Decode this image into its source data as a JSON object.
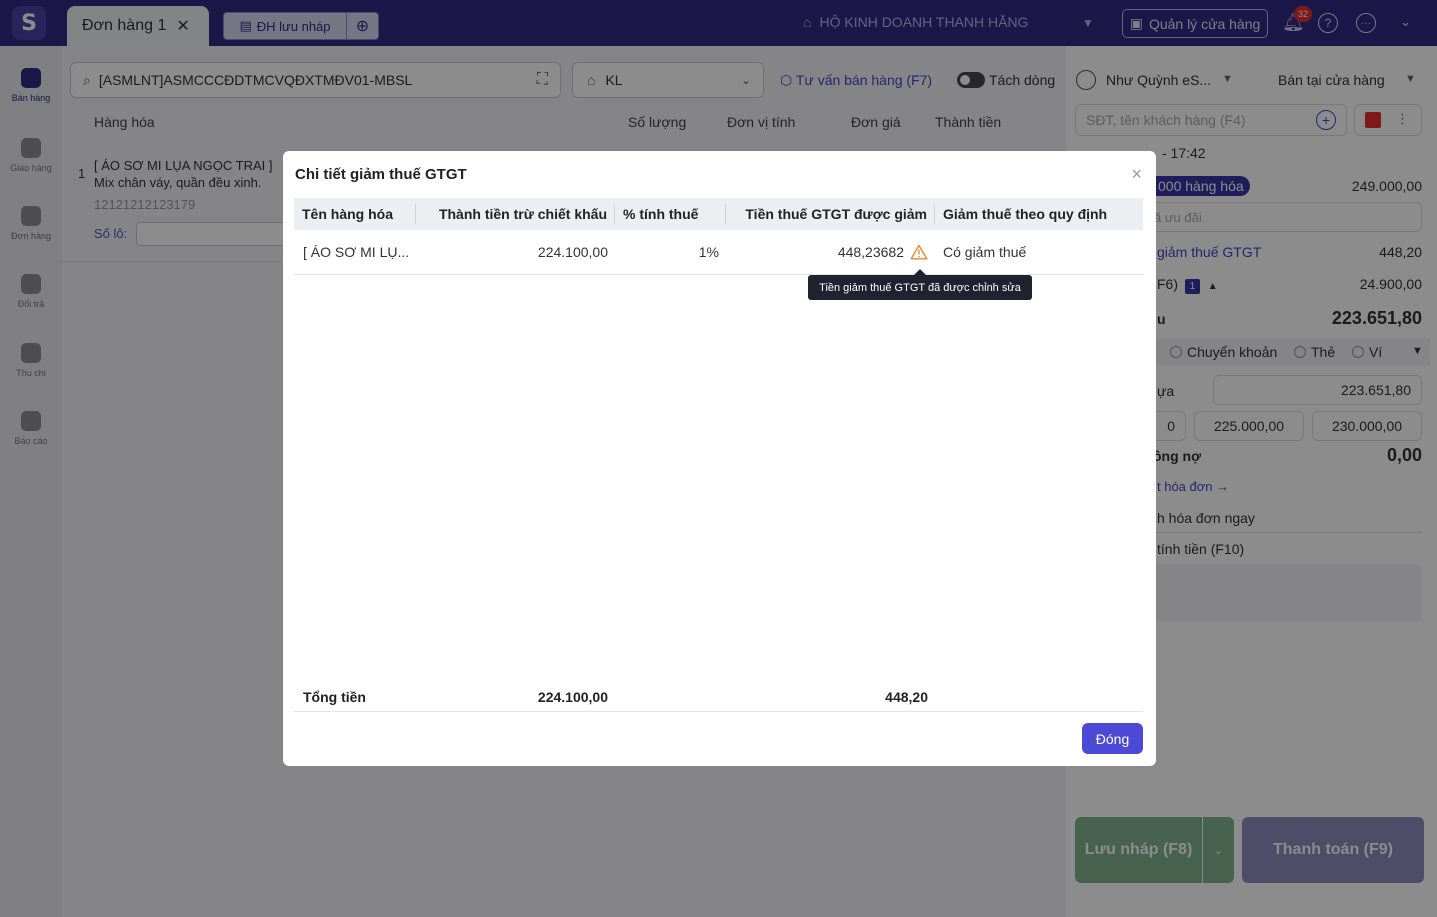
{
  "topbar": {
    "logo": "S",
    "active_tab": "Đơn hàng",
    "active_tab_number": "1",
    "close_glyph": "✕",
    "draft_tab": "ĐH lưu nháp",
    "store_name": "HỘ KINH DOANH THANH HẰNG",
    "manage_button": "Quản lý cửa hàng",
    "notification_count": "32",
    "help_glyph": "?",
    "more_glyph": "···",
    "icons": [
      "store-icon",
      "bell-icon",
      "help-icon",
      "more-icon",
      "chevron-down-icon"
    ]
  },
  "sidebar": {
    "items": [
      {
        "label": "Bán hàng",
        "active": true
      },
      {
        "label": "Giao hàng",
        "active": false
      },
      {
        "label": "Đơn hàng",
        "active": false
      },
      {
        "label": "Đổi trả",
        "active": false
      },
      {
        "label": "Thu chi",
        "active": false
      },
      {
        "label": "Báo cáo",
        "active": false
      }
    ]
  },
  "main": {
    "search_value": "[ASMLNT]ASMCCCĐDTMCVQĐXTMĐV01-MBSL",
    "price_list": "KL",
    "advise_link": "Tư vấn bán hàng (F7)",
    "split_line_label": "Tách dòng",
    "columns": [
      "Hàng hóa",
      "Số lượng",
      "Đơn vị tính",
      "Đơn giá",
      "Thành tiền"
    ],
    "product": {
      "index": "1",
      "name_line1": "[ ÁO SƠ MI LỤA NGỌC TRAI ]",
      "name_line2": "Mix chân váy, quần đều xinh.",
      "code": "12121212123179",
      "lot_label": "Số lô:"
    }
  },
  "right_panel": {
    "staff": "Như Quỳnh eS...",
    "sale_mode": "Bán tại cửa hàng",
    "customer_placeholder": "SĐT, tên khách hàng (F4)",
    "time": "- 17:42",
    "goods_count_label": "000 hàng hóa",
    "goods_total": "249.000,00",
    "promo_placeholder": "ã ưu đãi",
    "vat_reduce_label": "giảm thuế GTGT",
    "vat_reduce_value": "448,20",
    "discount_label": "F6)",
    "discount_badge": "1",
    "discount_value": "24.900,00",
    "must_pay_label": "u",
    "must_pay_value": "223.651,80",
    "payment_methods": [
      "Chuyển khoản",
      "Thẻ",
      "Ví"
    ],
    "paid_label": "ựa",
    "paid_value": "223.651,80",
    "quick_amounts": [
      "0",
      "225.000,00",
      "230.000,00"
    ],
    "debt_label": "ông nợ",
    "debt_value": "0,00",
    "invoice_link": "t hóa đơn →",
    "invoice_now": "h hóa đơn ngay",
    "calc_label": "tính tiền (F10)",
    "save_button": "Lưu nháp (F8)",
    "pay_button": "Thanh toán (F9)"
  },
  "modal": {
    "title": "Chi tiết giảm thuế GTGT",
    "close_glyph": "×",
    "headers": [
      "Tên hàng hóa",
      "Thành tiền trừ chiết khấu",
      "% tính thuế",
      "Tiền thuế GTGT được giảm",
      "Giảm thuế theo quy định"
    ],
    "row": {
      "name": "[ ÁO SƠ MI LỤ...",
      "amount": "224.100,00",
      "tax_rate": "1%",
      "vat_reduced": "448,23682",
      "rule": "Có giảm thuế"
    },
    "tooltip": "Tiền giảm thuế GTGT đã được chỉnh sửa",
    "footer": {
      "label": "Tổng tiền",
      "amount_total": "224.100,00",
      "vat_total": "448,20"
    },
    "close_button": "Đóng",
    "warning_color": "#e8862d",
    "accent_color": "#4c49d6"
  }
}
